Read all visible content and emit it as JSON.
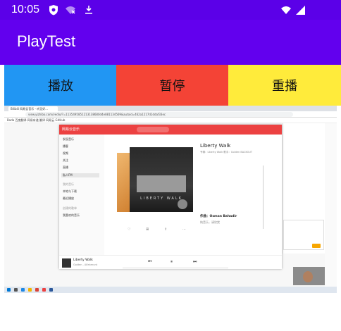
{
  "status_bar": {
    "time": "10:05",
    "icons": [
      "shield-icon",
      "wifi-off-icon",
      "download-icon",
      "wifi-icon",
      "signal-icon"
    ]
  },
  "app_bar": {
    "title": "PlayTest"
  },
  "controls": {
    "play_label": "播放",
    "pause_label": "暂停",
    "replay_label": "重播"
  },
  "video_content": {
    "browser_tab": "Bilibili 网易云音乐 - 听见好...",
    "url": "view.yizhibo.com/vedio/?=1135495851213138680d4e881134569&autoid=462a1217d1ddaf33ec",
    "bookmarks": "Bada  百度翻译  网易有道  翻译  网易云  GitHub",
    "music_app": {
      "brand": "网易云音乐",
      "sidebar": [
        "发现音乐",
        "播客",
        "视频",
        "关注",
        "直播",
        "私人FM",
        "我的音乐",
        "本地与下载",
        "最近播放",
        "创建的歌单",
        "我喜欢的音乐"
      ],
      "song_title": "Liberty Walk",
      "song_meta": "专辑：Liberty Walk    歌手：Golden BACKOUT",
      "cover_text": "LIBERTY WALK",
      "lyric_author": "作曲：Osman Bahadir",
      "lyric_line": "纯音乐，请欣赏",
      "player_title": "Liberty Walk",
      "player_sub": "Golden - Alfahmunt"
    }
  },
  "colors": {
    "status_bar": "#5b00e8",
    "app_bar": "#6200ee",
    "play": "#2196f3",
    "pause": "#f44336",
    "replay": "#ffeb3b",
    "music_red": "#ec4141"
  }
}
